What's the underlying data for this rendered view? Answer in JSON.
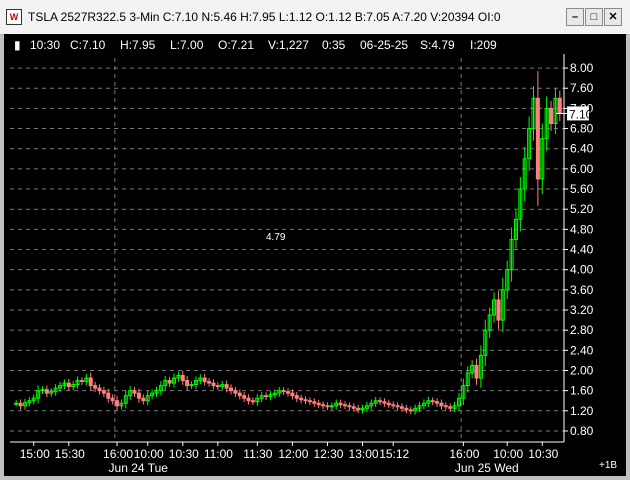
{
  "window": {
    "title": "TSLA 2527R322.5 3-Min C:7.10 N:5.46 H:7.95 L:1.12 O:1.12 B:7.05 A:7.20 V:20394 OI:0",
    "icon": "chart-app-icon",
    "buttons": [
      "minimize",
      "maximize",
      "close"
    ]
  },
  "infobar": {
    "time": "10:30",
    "close": "C:7.10",
    "high": "H:7.95",
    "low": "L:7.00",
    "open": "O:7.21",
    "volume": "V:1,227",
    "duration": "0:35",
    "date": "06-25-25",
    "spread": "S:4.79",
    "index": "I:209"
  },
  "annotation": "4.79",
  "current_price_label": "7.10",
  "scroll_label": "+1B",
  "chart_data": {
    "type": "candlestick",
    "title": "",
    "y_ticks": [
      "8.00",
      "7.60",
      "7.20",
      "6.80",
      "6.40",
      "6.00",
      "5.60",
      "5.20",
      "4.80",
      "4.40",
      "4.00",
      "3.60",
      "3.20",
      "2.80",
      "2.40",
      "2.00",
      "1.60",
      "1.20",
      "0.80"
    ],
    "ylim": [
      0.7,
      8.2
    ],
    "x_ticks": [
      "15:00",
      "15:30",
      "16:00",
      "10:00",
      "10:30",
      "11:00",
      "11:30",
      "12:00",
      "12:30",
      "13:00",
      "15:12",
      "16:00",
      "10:00",
      "10:30"
    ],
    "date_labels": [
      "Jun 24 Tue",
      "Jun 25 Wed"
    ],
    "up_color": "#00ff00",
    "down_color": "#ff8080",
    "closes": [
      1.35,
      1.3,
      1.36,
      1.4,
      1.45,
      1.6,
      1.62,
      1.55,
      1.58,
      1.65,
      1.7,
      1.75,
      1.68,
      1.72,
      1.8,
      1.78,
      1.85,
      1.7,
      1.65,
      1.6,
      1.55,
      1.45,
      1.4,
      1.3,
      1.35,
      1.5,
      1.6,
      1.55,
      1.45,
      1.4,
      1.5,
      1.55,
      1.6,
      1.7,
      1.8,
      1.75,
      1.85,
      1.9,
      1.8,
      1.7,
      1.72,
      1.8,
      1.85,
      1.78,
      1.75,
      1.7,
      1.68,
      1.72,
      1.65,
      1.6,
      1.55,
      1.5,
      1.45,
      1.4,
      1.38,
      1.45,
      1.5,
      1.48,
      1.52,
      1.55,
      1.6,
      1.58,
      1.55,
      1.5,
      1.45,
      1.42,
      1.4,
      1.38,
      1.35,
      1.32,
      1.3,
      1.28,
      1.3,
      1.35,
      1.32,
      1.3,
      1.28,
      1.25,
      1.22,
      1.25,
      1.3,
      1.35,
      1.4,
      1.38,
      1.35,
      1.32,
      1.3,
      1.28,
      1.25,
      1.22,
      1.2,
      1.25,
      1.3,
      1.35,
      1.4,
      1.38,
      1.35,
      1.3,
      1.28,
      1.25,
      1.3,
      1.45,
      1.7,
      1.95,
      2.1,
      1.85,
      2.3,
      2.8,
      3.1,
      3.4,
      3.0,
      3.6,
      4.0,
      4.6,
      5.0,
      5.6,
      6.2,
      6.8,
      7.4,
      5.8,
      6.6,
      7.2,
      6.9,
      7.4,
      7.1
    ],
    "session_breaks": [
      23,
      102
    ],
    "price_marker": 7.1,
    "annotation_value": 4.79
  }
}
